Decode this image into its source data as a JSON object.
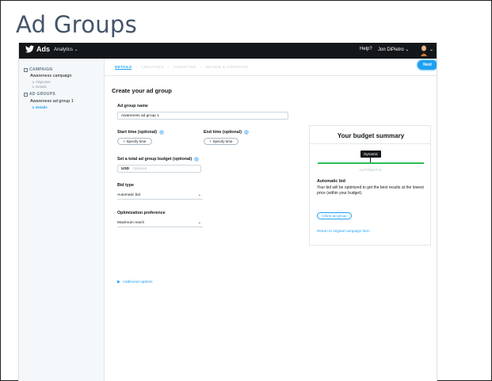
{
  "slide": {
    "title": "Ad Groups"
  },
  "topbar": {
    "brand": "Ads",
    "analytics": "Analytics ⌄",
    "help": "Help?",
    "user": "Jon DiPietro ⌄",
    "avatar_caret": "⌄"
  },
  "sidebar": {
    "campaign_header": "CAMPAIGN",
    "campaign_name": "Awareness campaign",
    "campaign_subs": [
      "↳ Objective",
      "↳ Details"
    ],
    "adgroups_header": "AD GROUPS",
    "adgroup_name": "Awareness ad group 1",
    "adgroup_sub": "↳ Details"
  },
  "steps": {
    "items": [
      "DETAILS",
      "CREATIVES",
      "TARGETING",
      "REVIEW & COMPLETE"
    ],
    "separator": "›",
    "active": "DETAILS"
  },
  "toolbar": {
    "next_label": "Next"
  },
  "form": {
    "title": "Create your ad group",
    "name_label": "Ad group name",
    "name_value": "Awareness ad group 1",
    "start_label": "Start time (optional)",
    "start_button": "+ Specify time",
    "end_label": "End time (optional)",
    "end_button": "+ Specify time",
    "budget_label": "Set a total ad group budget (optional)",
    "budget_currency": "USD",
    "budget_placeholder": "Optional",
    "bid_label": "Bid type",
    "bid_value": "Automatic bid",
    "opt_label": "Optimization preference",
    "opt_value": "Maximum reach",
    "additional_options": "Additional options"
  },
  "summary": {
    "title": "Your budget summary",
    "tooltip": "Dynamic",
    "bar_label": "AUTOMATIC",
    "bid_title": "Automatic bid",
    "bid_desc": "Your bid will be optimized to get the best results at the lowest price (within your budget).",
    "clone_button": "Clone ad group",
    "return_link": "Return to original campaign form"
  },
  "colors": {
    "accent": "#1da1f2",
    "topbar": "#14171a",
    "success_bar": "#2ebd59"
  }
}
